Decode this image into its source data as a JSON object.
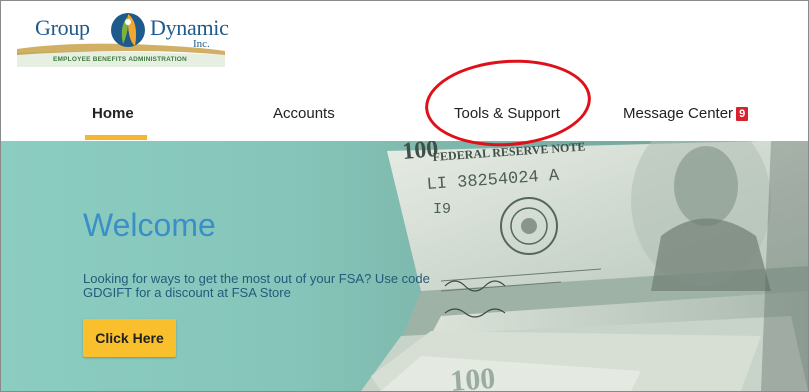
{
  "logo": {
    "word1": "Group",
    "word2": "Dynamic",
    "suffix": "Inc.",
    "tagline": "EMPLOYEE BENEFITS ADMINISTRATION"
  },
  "nav": {
    "items": [
      {
        "label": "Home",
        "active": true
      },
      {
        "label": "Accounts"
      },
      {
        "label": "Tools & Support"
      },
      {
        "label": "Message Center",
        "badge": "9"
      }
    ]
  },
  "hero": {
    "title": "Welcome",
    "promo": "Looking for ways to get the most out of your FSA? Use code GDGIFT for a discount at FSA Store",
    "cta_label": "Click Here",
    "bill_serial": "LI 38254024 A",
    "bill_series": "I9",
    "bill_header": "FEDERAL RESERVE NOTE",
    "bill_denomination": "100"
  },
  "colors": {
    "brand_blue": "#1e5a8c",
    "accent_yellow": "#f5b731",
    "badge_red": "#d7232f",
    "hero_teal": "#86c6ba",
    "annotation_red": "#e0101a"
  }
}
